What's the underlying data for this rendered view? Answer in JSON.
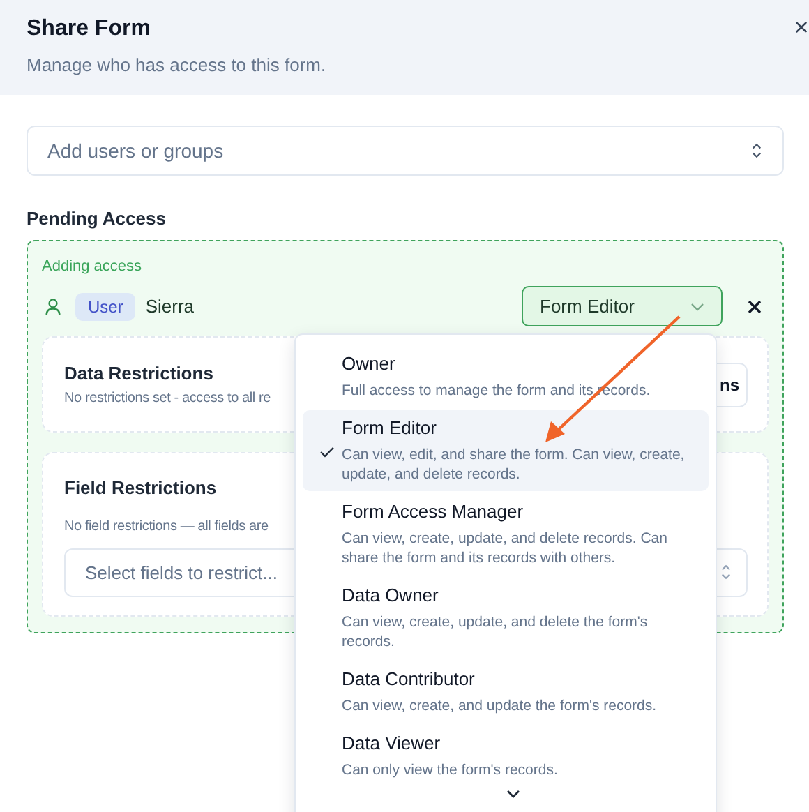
{
  "dialog": {
    "title": "Share Form",
    "subtitle": "Manage who has access to this form."
  },
  "search": {
    "placeholder": "Add users or groups"
  },
  "pending": {
    "heading": "Pending Access",
    "status": "Adding access",
    "entry": {
      "type": "User",
      "name": "Sierra",
      "role": "Form Editor"
    },
    "data_restrictions": {
      "title": "Data Restrictions",
      "description": "No restrictions set - access to all re",
      "button": "ns"
    },
    "field_restrictions": {
      "title": "Field Restrictions",
      "description": "No field restrictions — all fields are",
      "placeholder": "Select fields to restrict..."
    }
  },
  "role_menu": {
    "open": true,
    "options": [
      {
        "title": "Owner",
        "description": "Full access to manage the form and its records.",
        "selected": false
      },
      {
        "title": "Form Editor",
        "description": "Can view, edit, and share the form. Can view, create, update, and delete records.",
        "selected": true
      },
      {
        "title": "Form Access Manager",
        "description": "Can view, create, update, and delete records. Can share the form and its records with others.",
        "selected": false
      },
      {
        "title": "Data Owner",
        "description": "Can view, create, update, and delete the form's records.",
        "selected": false
      },
      {
        "title": "Data Contributor",
        "description": "Can view, create, and update the form's records.",
        "selected": false
      },
      {
        "title": "Data Viewer",
        "description": "Can only view the form's records.",
        "selected": false
      }
    ]
  }
}
